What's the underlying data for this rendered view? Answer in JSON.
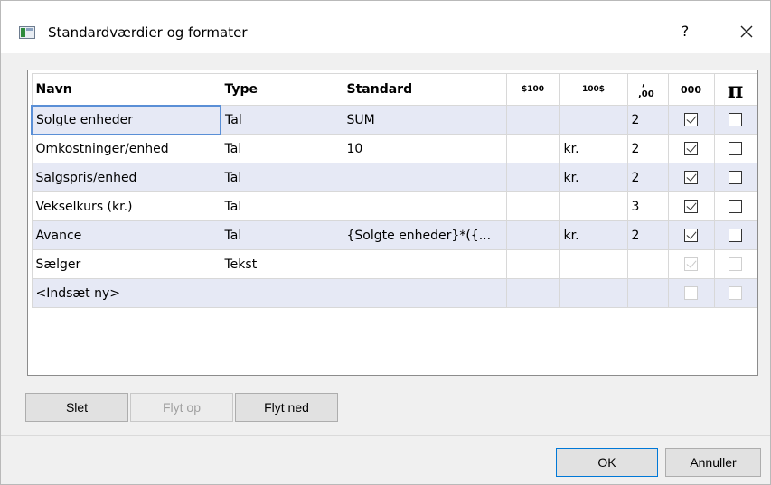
{
  "window": {
    "title": "Standardværdier og formater",
    "help_label": "?"
  },
  "grid": {
    "headers": [
      "Navn",
      "Type",
      "Standard",
      "$100",
      "100$",
      ",0\n,00",
      "000",
      "π"
    ],
    "rows": [
      {
        "name": "Solgte enheder",
        "type": "Tal",
        "standard": "SUM",
        "prefix": "",
        "suffix": "",
        "decimals": "2",
        "thousands": true,
        "pi": false,
        "thousands_disabled": false
      },
      {
        "name": "Omkostninger/enhed",
        "type": "Tal",
        "standard": "10",
        "prefix": "",
        "suffix": "kr.",
        "decimals": "2",
        "thousands": true,
        "pi": false,
        "thousands_disabled": false
      },
      {
        "name": "Salgspris/enhed",
        "type": "Tal",
        "standard": "",
        "prefix": "",
        "suffix": "kr.",
        "decimals": "2",
        "thousands": true,
        "pi": false,
        "thousands_disabled": false
      },
      {
        "name": "Vekselkurs (kr.)",
        "type": "Tal",
        "standard": "",
        "prefix": "",
        "suffix": "",
        "decimals": "3",
        "thousands": true,
        "pi": false,
        "thousands_disabled": false
      },
      {
        "name": "Avance",
        "type": "Tal",
        "standard": "{Solgte  enheder}*({...",
        "prefix": "",
        "suffix": "kr.",
        "decimals": "2",
        "thousands": true,
        "pi": false,
        "thousands_disabled": false
      },
      {
        "name": "Sælger",
        "type": "Tekst",
        "standard": "",
        "prefix": "",
        "suffix": "",
        "decimals": "",
        "thousands": true,
        "pi": false,
        "thousands_disabled": true
      },
      {
        "name": "<Indsæt ny>",
        "type": "",
        "standard": "",
        "prefix": "",
        "suffix": "",
        "decimals": "",
        "thousands": false,
        "pi": false,
        "thousands_disabled": true
      }
    ]
  },
  "buttons": {
    "delete": "Slet",
    "move_up": "Flyt op",
    "move_down": "Flyt ned",
    "ok": "OK",
    "cancel": "Annuller"
  }
}
